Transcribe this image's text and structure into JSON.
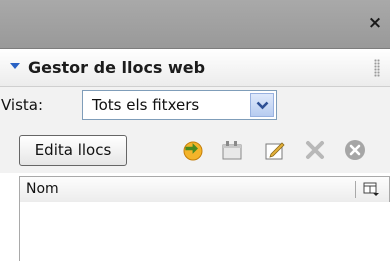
{
  "window": {
    "close_symbol": "×"
  },
  "panel": {
    "title": "Gestor de llocs web",
    "collapse_icon": "triangle-down-icon",
    "accent_color": "#2a62c4"
  },
  "view": {
    "label": "Vista:",
    "selected": "Tots els fitxers"
  },
  "toolbar": {
    "edit_label": "Edita llocs",
    "icons": [
      "connect-icon",
      "new-folder-icon",
      "new-file-icon",
      "disconnect-icon",
      "delete-icon"
    ]
  },
  "list": {
    "columns": [
      "Nom"
    ],
    "rows": []
  }
}
